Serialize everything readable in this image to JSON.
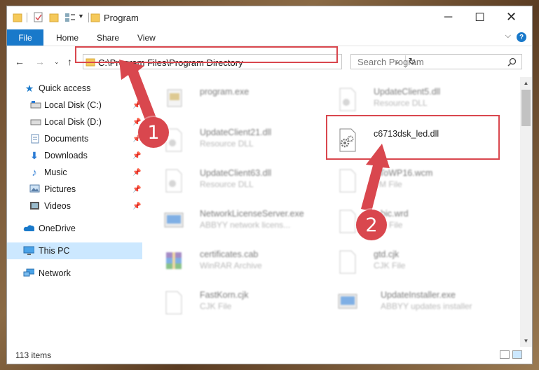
{
  "window": {
    "title": "Program"
  },
  "ribbon": {
    "file": "File",
    "tabs": [
      "Home",
      "Share",
      "View"
    ],
    "help": "?"
  },
  "address": {
    "path": "C:\\Program Files\\Program Directory"
  },
  "search": {
    "placeholder": "Search Program"
  },
  "sidebar": {
    "items": [
      {
        "label": "Quick access",
        "icon": "star-icon"
      },
      {
        "label": "Local Disk (C:)",
        "icon": "drive-icon"
      },
      {
        "label": "Local Disk (D:)",
        "icon": "drive-icon"
      },
      {
        "label": "Documents",
        "icon": "documents-icon"
      },
      {
        "label": "Downloads",
        "icon": "download-icon"
      },
      {
        "label": "Music",
        "icon": "music-icon"
      },
      {
        "label": "Pictures",
        "icon": "pictures-icon"
      },
      {
        "label": "Videos",
        "icon": "videos-icon"
      },
      {
        "label": "OneDrive",
        "icon": "cloud-icon"
      },
      {
        "label": "This PC",
        "icon": "computer-icon"
      },
      {
        "label": "Network",
        "icon": "network-icon"
      }
    ]
  },
  "files": [
    {
      "name": "program.exe",
      "desc": ""
    },
    {
      "name": "UpdateClient5.dll",
      "desc": "Resource DLL"
    },
    {
      "name": "UpdateClient21.dll",
      "desc": "Resource DLL"
    },
    {
      "name": "c6713dsk_led.dll",
      "desc": ""
    },
    {
      "name": "UpdateClient63.dll",
      "desc": "Resource DLL"
    },
    {
      "name": "ToWP16.wcm",
      "desc": "M File"
    },
    {
      "name": "NetworkLicenseServer.exe",
      "desc": "ABBYY network licens..."
    },
    {
      "name": "bic.wrd",
      "desc": "D File"
    },
    {
      "name": "certificates.cab",
      "desc": "WinRAR Archive"
    },
    {
      "name": "gtd.cjk",
      "desc": "CJK File"
    },
    {
      "name": "FastKorn.cjk",
      "desc": "CJK File"
    },
    {
      "name": "UpdateInstaller.exe",
      "desc": "ABBYY updates installer"
    }
  ],
  "status": {
    "count": "113 items"
  },
  "callouts": [
    "1",
    "2"
  ],
  "colors": {
    "accent": "#1979ca",
    "highlight": "#d9474e",
    "selected": "#cce8ff"
  }
}
